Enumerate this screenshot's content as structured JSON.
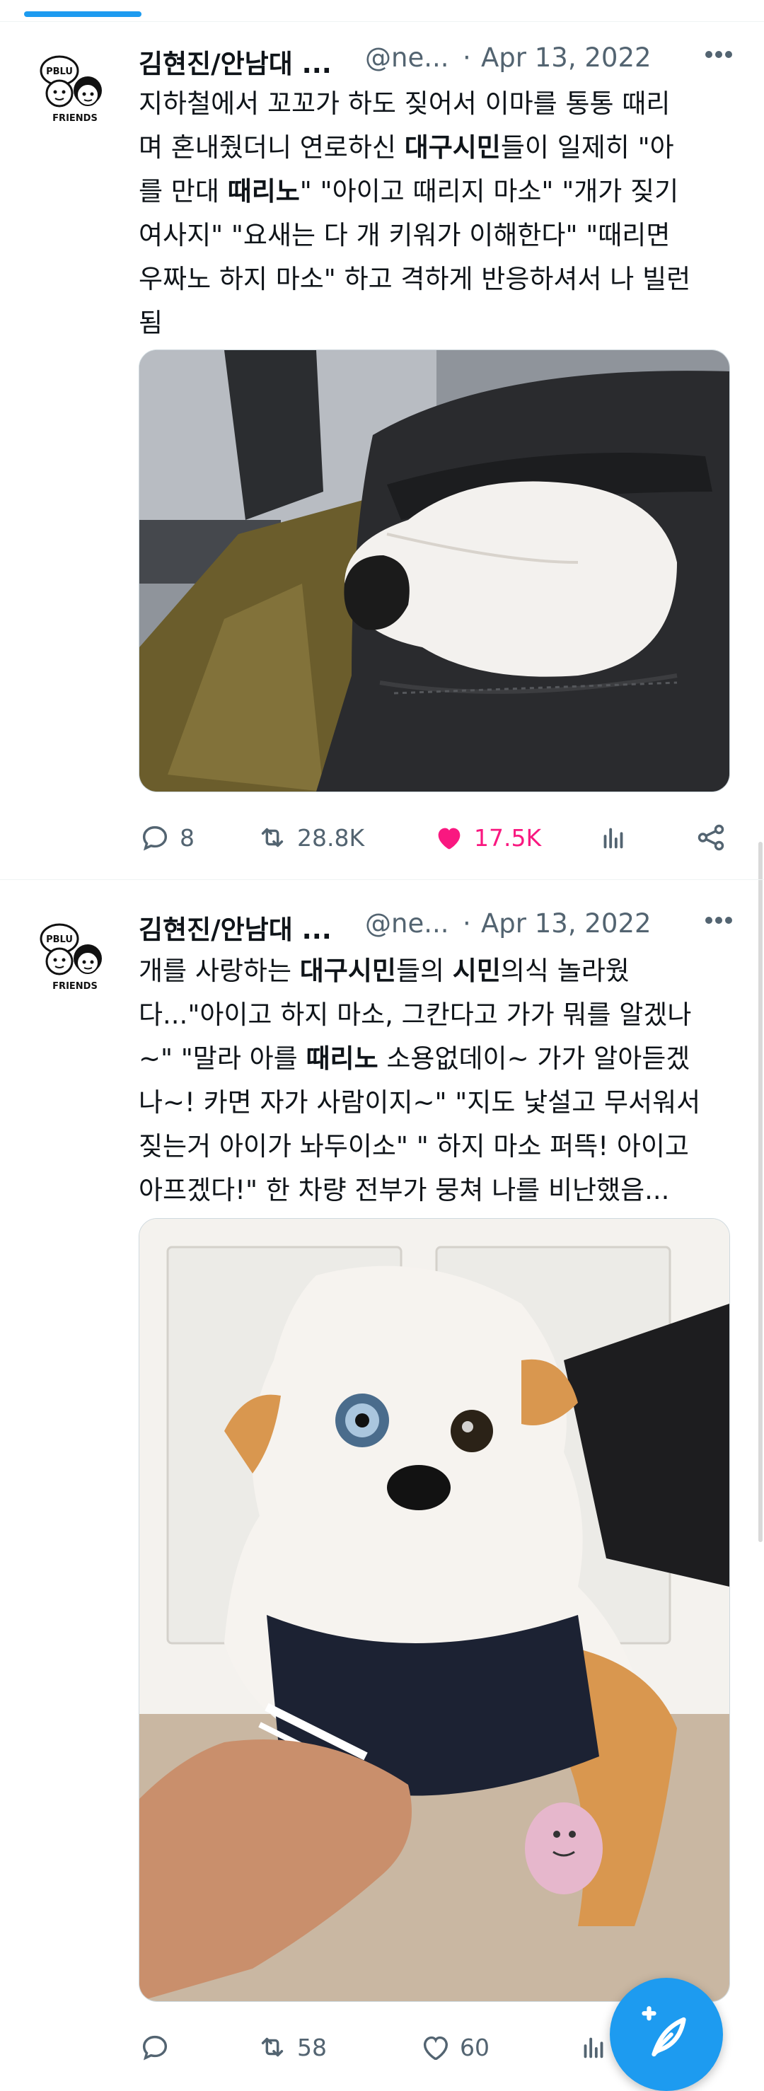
{
  "tweets": [
    {
      "name": "김현진/안남대 ...",
      "handle": "@ne...",
      "dot": "·",
      "date": "Apr 13, 2022",
      "lines": [
        "지하철에서 꼬꼬가 하도 짖어서 이마를 통통 때리",
        "며 혼내줬더니 연로하신 |대구시민|들이 일제히 \"아",
        "를 만대 |때리노|\" \"아이고 때리지 마소\" \"개가 짖기",
        "여사지\" \"요새는 다 개 키워가 이해한다\" \"때리면",
        "우짜노 하지 마소\" 하고 격하게 반응하셔서 나 빌런",
        "됨"
      ],
      "image_alt": "white dog peeking out of black bag on subway",
      "stats": {
        "replies": "8",
        "retweets": "28.8K",
        "likes": "17.5K"
      }
    },
    {
      "name": "김현진/안남대 ...",
      "handle": "@ne...",
      "dot": "·",
      "date": "Apr 13, 2022",
      "lines": [
        "개를 사랑하는 |대구시민|들의 |시민|의식 놀라웠",
        "다...\"아이고 하지 마소, 그칸다고 가가 뭐를 알겠나",
        "~\" \"말라 아를 |때리노| 소용없데이~ 가가 알아듣겠",
        "나~! 카면 자가 사람이지~\" \"지도 낯설고 무서워서",
        "짖는거 아이가 놔두이소\" \" 하지 마소 퍼뜩! 아이고",
        "아프겠다!\" 한 차량 전부가 뭉쳐 나를 비난했음..."
      ],
      "image_alt": "chihuahua with blue eye wearing navy jacket held by hand",
      "stats": {
        "replies": "",
        "retweets": "58",
        "likes": "60"
      }
    }
  ],
  "avatar": {
    "badge_text": "PBLU",
    "caption": "FRIENDS"
  },
  "colors": {
    "accent": "#1d9bf0",
    "like": "#f91880",
    "muted": "#536471",
    "text": "#0f1419"
  }
}
